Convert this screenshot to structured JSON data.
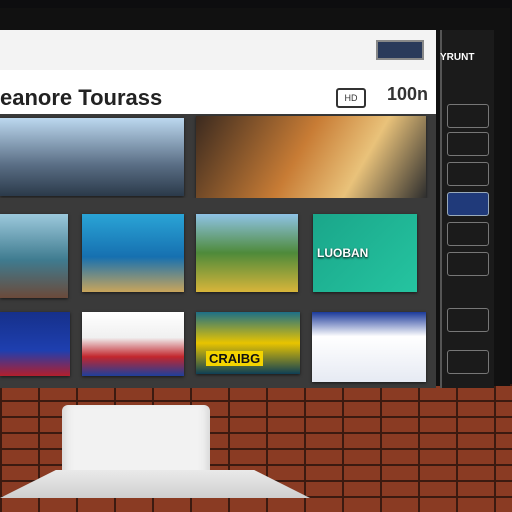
{
  "screen": {
    "title": "eanore Tourass",
    "badge": "HD",
    "count": "100n"
  },
  "side": {
    "title": "YRUNT",
    "items": [
      "",
      "",
      "",
      "",
      "",
      "",
      "",
      ""
    ]
  },
  "tiles": {
    "big1": "",
    "big2": "",
    "row2": [
      "",
      "",
      "",
      "LUOBAN"
    ],
    "row3": [
      "",
      "",
      "CRAIBG",
      ""
    ]
  },
  "colors": {
    "accent": "#203a7a",
    "screen_bg": "#ffffff",
    "panel_bg": "#1b1b1b",
    "brick": "#8a3b23"
  }
}
